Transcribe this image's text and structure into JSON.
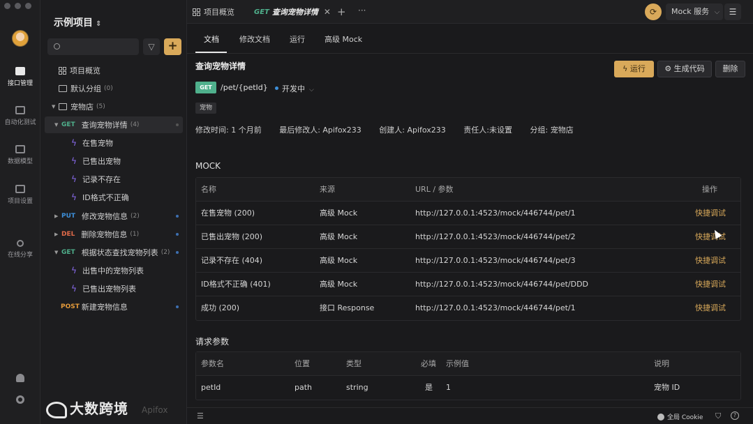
{
  "rail": {
    "items": [
      {
        "label": "接口管理",
        "active": true
      },
      {
        "label": "自动化测试"
      },
      {
        "label": "数据模型"
      },
      {
        "label": "项目设置"
      },
      {
        "label": "在线分享"
      }
    ]
  },
  "sidebar": {
    "project_title": "示例项目",
    "filter_icon": "funnel-icon",
    "add_label": "+",
    "nodes": [
      {
        "label": "项目概览"
      },
      {
        "label": "默认分组",
        "count": "(0)"
      },
      {
        "label": "宠物店",
        "count": "(5)"
      },
      {
        "method": "GET",
        "label": "查询宠物详情",
        "count": "(4)"
      },
      {
        "label": "在售宠物"
      },
      {
        "label": "已售出宠物"
      },
      {
        "label": "记录不存在"
      },
      {
        "label": "ID格式不正确"
      },
      {
        "method": "PUT",
        "label": "修改宠物信息",
        "count": "(2)"
      },
      {
        "method": "DEL",
        "label": "删除宠物信息",
        "count": "(1)"
      },
      {
        "method": "GET",
        "label": "根据状态查找宠物列表",
        "count": "(2)"
      },
      {
        "label": "出售中的宠物列表"
      },
      {
        "label": "已售出宠物列表"
      },
      {
        "method": "POST",
        "label": "新建宠物信息"
      }
    ],
    "watermark": "大数跨境",
    "watermark_apifox": "Apifox"
  },
  "topbar": {
    "tabs": [
      {
        "label": "项目概览"
      },
      {
        "method": "GET",
        "label": "查询宠物详情",
        "close": "✕"
      }
    ],
    "plus": "+",
    "more": "···",
    "mock_service": "Mock 服务",
    "mock_service_chevron": "⌵"
  },
  "main": {
    "subtabs": [
      "文档",
      "修改文档",
      "运行",
      "高级 Mock"
    ],
    "title": "查询宠物详情",
    "actions": {
      "run": "运行",
      "gen": "生成代码",
      "delete": "删除"
    },
    "method": "GET",
    "path": "/pet/{petId}",
    "status": "开发中",
    "tag": "宠物",
    "meta": {
      "modified": "修改时间: 1 个月前",
      "modifier": "最后修改人: Apifox233",
      "creator": "创建人: Apifox233",
      "owner": "责任人:未设置",
      "group": "分组: 宠物店"
    },
    "mock": {
      "title": "MOCK",
      "headers": [
        "名称",
        "来源",
        "URL / 参数",
        "操作"
      ],
      "rows": [
        {
          "name": "在售宠物 (200)",
          "source": "高级 Mock",
          "url": "http://127.0.0.1:4523/mock/446744/pet/1",
          "action": "快捷调试"
        },
        {
          "name": "已售出宠物 (200)",
          "source": "高级 Mock",
          "url": "http://127.0.0.1:4523/mock/446744/pet/2",
          "action": "快捷调试"
        },
        {
          "name": "记录不存在 (404)",
          "source": "高级 Mock",
          "url": "http://127.0.0.1:4523/mock/446744/pet/3",
          "action": "快捷调试"
        },
        {
          "name": "ID格式不正确 (401)",
          "source": "高级 Mock",
          "url": "http://127.0.0.1:4523/mock/446744/pet/DDD",
          "action": "快捷调试"
        },
        {
          "name": "成功 (200)",
          "source": "接口 Response",
          "url": "http://127.0.0.1:4523/mock/446744/pet/1",
          "action": "快捷调试"
        }
      ]
    },
    "params": {
      "title": "请求参数",
      "headers": [
        "参数名",
        "位置",
        "类型",
        "必填",
        "示例值",
        "说明"
      ],
      "rows": [
        {
          "name": "petId",
          "position": "path",
          "type": "string",
          "required": "是",
          "example": "1",
          "desc": "宠物 ID"
        }
      ]
    }
  },
  "statusbar": {
    "cookie": "全局 Cookie"
  },
  "colors": {
    "accent": "#d9a95a",
    "get": "#4fb08c",
    "put": "#3d8fd9",
    "del": "#e36b4a",
    "post": "#e49a3a",
    "mock_bolt": "#8b6cf0"
  }
}
